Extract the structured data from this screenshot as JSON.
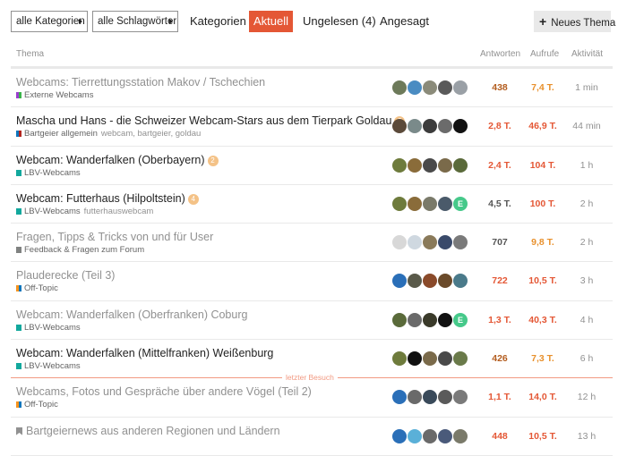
{
  "nav": {
    "categories_dropdown": "alle Kategorien",
    "tags_dropdown": "alle Schlagwörter",
    "tabs": [
      {
        "label": "Kategorien",
        "active": false
      },
      {
        "label": "Aktuell",
        "active": true
      },
      {
        "label": "Ungelesen (4)",
        "active": false
      },
      {
        "label": "Angesagt",
        "active": false
      }
    ],
    "new_topic_button": "Neues Thema",
    "new_topic_icon": "plus-icon"
  },
  "table_header": {
    "topic": "Thema",
    "replies": "Antworten",
    "views": "Aufrufe",
    "activity": "Aktivität"
  },
  "colors": {
    "accent": "#e45735",
    "heat_orange": "#e45735",
    "bubble_unread": "#f4c287",
    "last_visit_line": "#f29a82"
  },
  "last_visit_label": "letzter Besuch",
  "topics": [
    {
      "title": "Webcams: Tierrettungsstation Makov / Tschechien",
      "visited": true,
      "new_posts": "",
      "category": "Externe Webcams",
      "cat_color": "#9c3fce",
      "cat_color2": "#3ab54a",
      "tags": "",
      "posters": [
        "#6d7a5a",
        "#4a8cc2",
        "#8b8b7a",
        "#5a5a5a",
        "#9aa0a6"
      ],
      "replies": "438",
      "replies_color": "#b35c1e",
      "views": "7,4 T.",
      "views_color": "#e8902c",
      "activity": "1 min"
    },
    {
      "title": "Mascha und Hans - die Schweizer Webcam-Stars aus dem Tierpark Goldau",
      "visited": false,
      "new_posts": "3",
      "category": "Bartgeier allgemein",
      "cat_color": "#0e76bd",
      "cat_color2": "#b3251f",
      "tags": "webcam, bartgeier, goldau",
      "posters": [
        "#5b4a3a",
        "#7a8a8a",
        "#3c3c3c",
        "#6b6b6b",
        "#111111"
      ],
      "replies": "2,8 T.",
      "replies_color": "#e45735",
      "views": "46,9 T.",
      "views_color": "#e45735",
      "activity": "44 min"
    },
    {
      "title": "Webcam: Wanderfalken (Oberbayern)",
      "visited": false,
      "new_posts": "2",
      "category": "LBV-Webcams",
      "cat_color": "#12a89d",
      "cat_color2": "#12a89d",
      "tags": "",
      "posters": [
        "#6e7b3c",
        "#8a6c3a",
        "#4a4a4a",
        "#7a6a4a",
        "#5a6a3a"
      ],
      "replies": "2,4 T.",
      "replies_color": "#e45735",
      "views": "104 T.",
      "views_color": "#e45735",
      "activity": "1 h"
    },
    {
      "title": "Webcam: Futterhaus (Hilpoltstein)",
      "visited": false,
      "new_posts": "4",
      "category": "LBV-Webcams",
      "cat_color": "#12a89d",
      "cat_color2": "#12a89d",
      "tags": "futterhauswebcam",
      "posters": [
        "#6e7b3c",
        "#8a6c3a",
        "#7a7a6a",
        "#4a5a6a",
        "#46c98a"
      ],
      "replies": "4,5 T.",
      "replies_color": "#555555",
      "views": "100 T.",
      "views_color": "#e45735",
      "activity": "2 h"
    },
    {
      "title": "Fragen, Tipps & Tricks von und für User",
      "visited": true,
      "new_posts": "",
      "category": "Feedback & Fragen zum Forum",
      "cat_color": "#808281",
      "cat_color2": "#808281",
      "tags": "",
      "posters": [
        "#d8d8d8",
        "#cfd8e0",
        "#8a7a5a",
        "#3a4a6a",
        "#7a7a7a"
      ],
      "replies": "707",
      "replies_color": "#555555",
      "views": "9,8 T.",
      "views_color": "#e8902c",
      "activity": "2 h"
    },
    {
      "title": "Plauderecke (Teil 3)",
      "visited": true,
      "new_posts": "",
      "category": "Off-Topic",
      "cat_color": "#f7941d",
      "cat_color2": "#0e76bd",
      "tags": "",
      "posters": [
        "#2a6fb8",
        "#5a5a4a",
        "#8a4a2a",
        "#6a4a2a",
        "#4a7a8a"
      ],
      "replies": "722",
      "replies_color": "#e45735",
      "views": "10,5 T.",
      "views_color": "#e45735",
      "activity": "3 h"
    },
    {
      "title": "Webcam: Wanderfalken (Oberfranken) Coburg",
      "visited": true,
      "new_posts": "",
      "category": "LBV-Webcams",
      "cat_color": "#12a89d",
      "cat_color2": "#12a89d",
      "tags": "",
      "posters": [
        "#5a6a3a",
        "#6a6a6a",
        "#3a3a2a",
        "#111111",
        "#46c98a"
      ],
      "replies": "1,3 T.",
      "replies_color": "#e45735",
      "views": "40,3 T.",
      "views_color": "#e45735",
      "activity": "4 h"
    },
    {
      "title": "Webcam: Wanderfalken (Mittelfranken) Weißenburg",
      "visited": false,
      "new_posts": "",
      "category": "LBV-Webcams",
      "cat_color": "#12a89d",
      "cat_color2": "#12a89d",
      "tags": "",
      "posters": [
        "#6e7b3c",
        "#111111",
        "#7a6a4a",
        "#4a4a4a",
        "#6a7a4a"
      ],
      "replies": "426",
      "replies_color": "#b35c1e",
      "views": "7,3 T.",
      "views_color": "#e8902c",
      "activity": "6 h"
    },
    {
      "title": "Webcams, Fotos und Gespräche über andere Vögel (Teil 2)",
      "visited": true,
      "new_posts": "",
      "category": "Off-Topic",
      "cat_color": "#f7941d",
      "cat_color2": "#0e76bd",
      "tags": "",
      "posters": [
        "#2a6fb8",
        "#6a6a6a",
        "#3a4a5a",
        "#5a5a5a",
        "#7a7a7a"
      ],
      "replies": "1,1 T.",
      "replies_color": "#e45735",
      "views": "14,0 T.",
      "views_color": "#e45735",
      "activity": "12 h"
    },
    {
      "title": "Bartgeiernews aus anderen Regionen und Ländern",
      "visited": true,
      "new_posts": "",
      "pinned": true,
      "category": "",
      "cat_color": "#0e76bd",
      "cat_color2": "#0e76bd",
      "tags": "",
      "posters": [
        "#2a6fb8",
        "#5ab0d8",
        "#6a6a6a",
        "#4a5a7a",
        "#7a7a6a"
      ],
      "replies": "448",
      "replies_color": "#e45735",
      "views": "10,5 T.",
      "views_color": "#e45735",
      "activity": "13 h"
    }
  ]
}
